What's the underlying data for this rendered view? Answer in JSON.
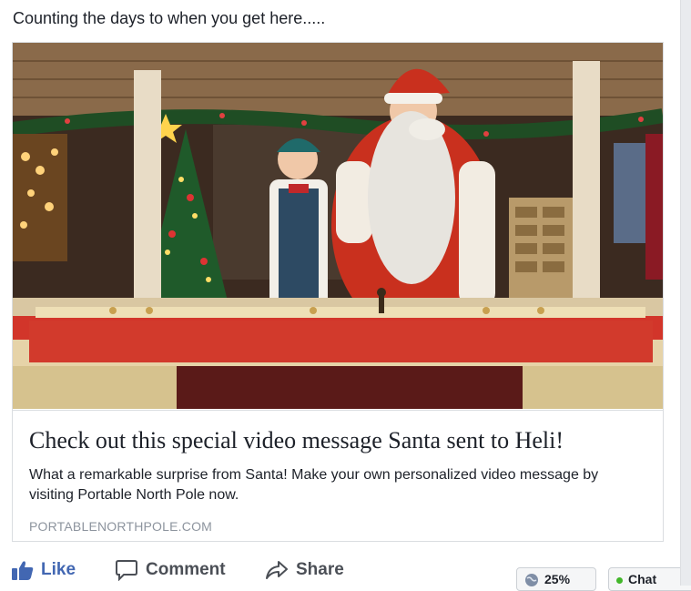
{
  "post": {
    "text": "Counting the days to when you get here....."
  },
  "link_card": {
    "title": "Check out this special video message Santa sent to Heli!",
    "description": "What a remarkable surprise from Santa! Make your own personalized video message by visiting Portable North Pole now.",
    "domain": "PORTABLENORTHPOLE.COM"
  },
  "actions": {
    "like_label": "Like",
    "comment_label": "Comment",
    "share_label": "Share"
  },
  "footer": {
    "zoom_label": "25%",
    "chat_label": "Chat"
  },
  "colors": {
    "link_blue": "#4267b2",
    "action_gray": "#4b4f56",
    "domain_gray": "#8d949e",
    "online_green": "#42b72a"
  },
  "icons": [
    "thumbs-up-icon",
    "comment-bubble-icon",
    "share-arrow-icon",
    "globe-icon"
  ]
}
